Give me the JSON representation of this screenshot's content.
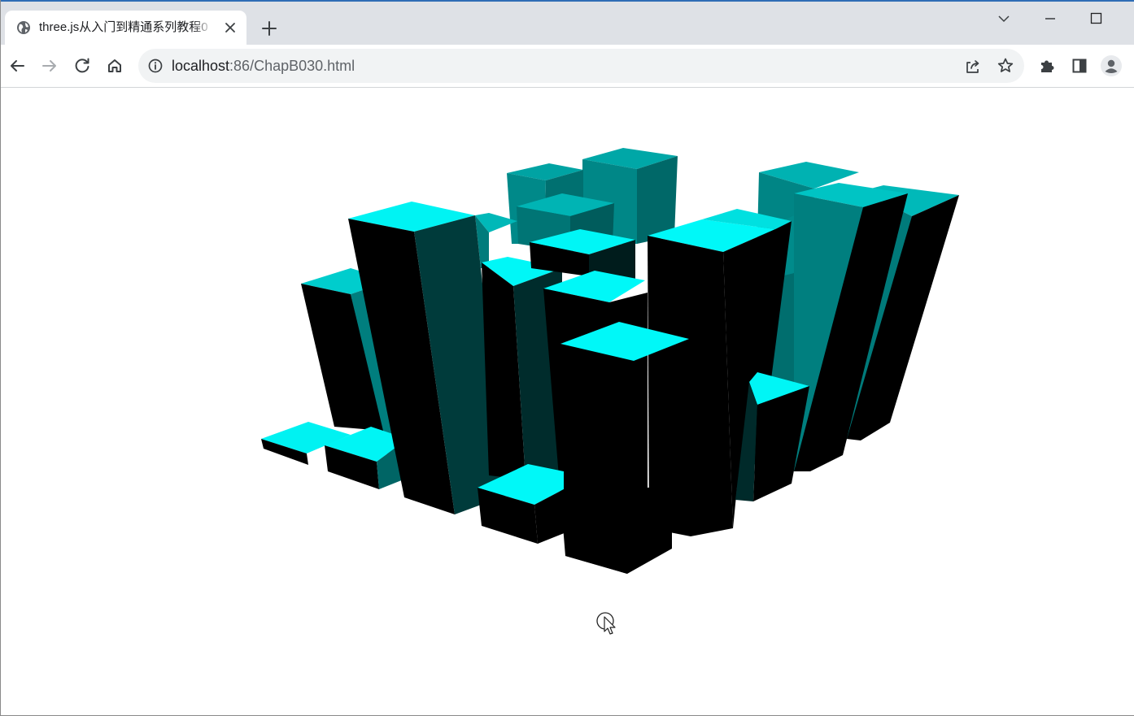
{
  "browser": {
    "tab": {
      "title": "three.js从入门到精通系列教程0",
      "favicon_icon": "globe-icon",
      "close_icon": "close-icon"
    },
    "new_tab_icon": "plus-icon",
    "window_controls": [
      "tab-search-chevron-icon",
      "minimize-icon",
      "maximize-icon"
    ],
    "nav": [
      "back-arrow-icon",
      "forward-arrow-icon",
      "reload-icon",
      "home-icon"
    ],
    "address": {
      "info_icon": "info-icon",
      "host": "localhost",
      "rest": ":86/ChapB030.html"
    },
    "omnibox_actions": [
      "share-icon",
      "bookmark-star-icon"
    ],
    "toolbar_actions": [
      "extensions-puzzle-icon",
      "side-panel-icon",
      "profile-avatar-icon"
    ],
    "colors": {
      "accent": "#2f6db5",
      "tabstrip": "#dee1e6",
      "omnibox": "#f1f3f4"
    }
  },
  "scene": {
    "description_icon": "3d-bar-scene",
    "colors": {
      "top_face": "#00ffff",
      "side_dark": "#000000",
      "side_teal": "#008b8b"
    },
    "cursor_icon": "pointer-cursor-icon"
  }
}
